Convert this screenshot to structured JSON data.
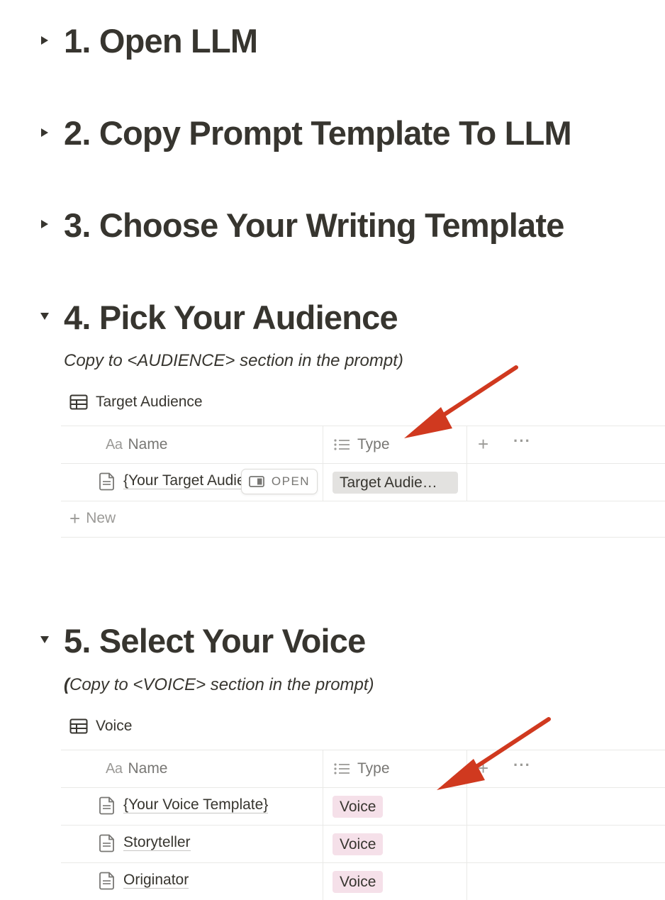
{
  "sections": [
    {
      "heading": "1. Open LLM",
      "expanded": false
    },
    {
      "heading": "2. Copy Prompt Template To LLM",
      "expanded": false
    },
    {
      "heading": "3. Choose Your Writing Template",
      "expanded": false
    },
    {
      "heading": "4. Pick Your Audience",
      "expanded": true
    },
    {
      "heading": "5. Select Your Voice",
      "expanded": true
    }
  ],
  "audience": {
    "subtitle": "Copy to <AUDIENCE> section in the prompt)",
    "database_title": "Target Audience",
    "columns": {
      "name": "Name",
      "name_icon": "Aa",
      "type": "Type"
    },
    "rows": [
      {
        "name": "{Your Target Audience}",
        "type": "Target Audie…",
        "open_label": "OPEN"
      }
    ],
    "new_label": "New"
  },
  "voice": {
    "subtitle_prefix": "(",
    "subtitle": "Copy to <VOICE> section in the prompt)",
    "database_title": "Voice",
    "columns": {
      "name": "Name",
      "name_icon": "Aa",
      "type": "Type"
    },
    "rows": [
      {
        "name": "{Your Voice Template}",
        "type": "Voice"
      },
      {
        "name": "Storyteller",
        "type": "Voice"
      },
      {
        "name": "Originator",
        "type": "Voice"
      }
    ]
  },
  "colors": {
    "text": "#37352f",
    "muted": "#787774",
    "tag_grey": "#e3e2e0",
    "tag_pink": "#f5e0e9",
    "annotation_arrow": "#d0391f"
  },
  "icons": [
    "triangle-right-icon",
    "triangle-down-icon",
    "table-icon",
    "list-icon",
    "plus-icon",
    "more-icon",
    "page-icon",
    "open-panel-icon"
  ]
}
